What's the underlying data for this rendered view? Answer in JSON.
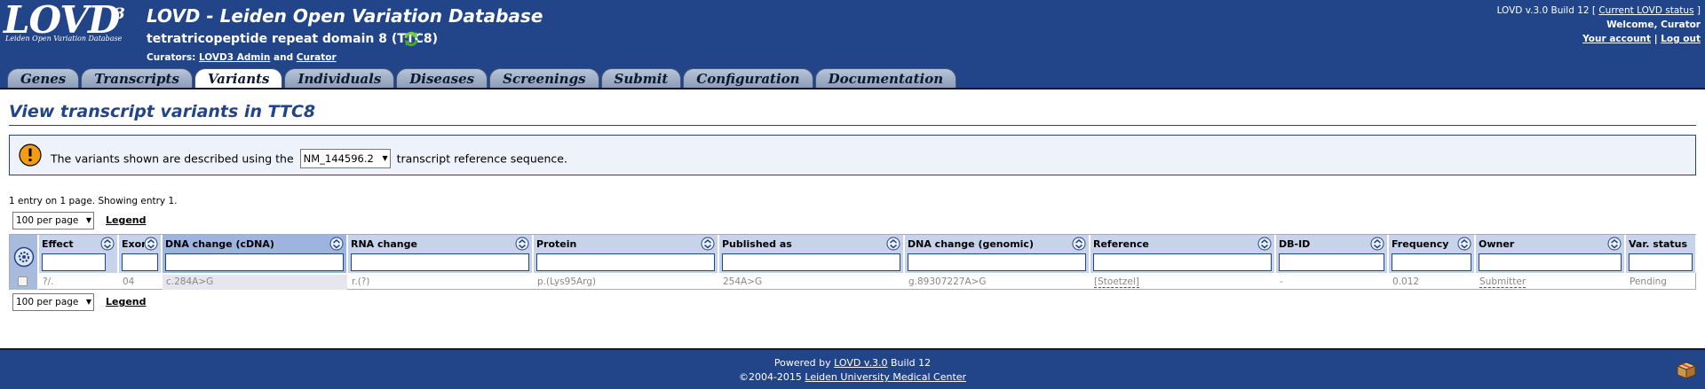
{
  "header": {
    "logo_text": "LOVD",
    "logo_version": "3",
    "logo_subtitle": "Leiden Open Variation Database",
    "app_title": "LOVD - Leiden Open Variation Database",
    "gene_title": "tetratricopeptide repeat domain 8 (TTC8)",
    "curators_prefix": "Curators:",
    "curator_1": "LOVD3 Admin",
    "curators_and": "and",
    "curator_2": "Curator",
    "version_text": "LOVD v.3.0 Build 12 [",
    "status_link": "Current LOVD status",
    "version_close": "]",
    "welcome": "Welcome, Curator",
    "account_link": "Your account",
    "separator": "|",
    "logout_link": "Log out"
  },
  "tabs": [
    {
      "label": "Genes",
      "active": false
    },
    {
      "label": "Transcripts",
      "active": false
    },
    {
      "label": "Variants",
      "active": true
    },
    {
      "label": "Individuals",
      "active": false
    },
    {
      "label": "Diseases",
      "active": false
    },
    {
      "label": "Screenings",
      "active": false
    },
    {
      "label": "Submit",
      "active": false
    },
    {
      "label": "Configuration",
      "active": false
    },
    {
      "label": "Documentation",
      "active": false
    }
  ],
  "page": {
    "heading": "View transcript variants in TTC8",
    "info_before": "The variants shown are described using the",
    "transcript_selected": "NM_144596.2",
    "info_after": "transcript reference sequence.",
    "entry_info": "1 entry on 1 page. Showing entry 1.",
    "per_page": "100 per page",
    "legend": "Legend"
  },
  "table": {
    "columns": [
      {
        "label": "Effect",
        "sorted": false
      },
      {
        "label": "Exon",
        "sorted": false
      },
      {
        "label": "DNA change (cDNA)",
        "sorted": true
      },
      {
        "label": "RNA change",
        "sorted": false
      },
      {
        "label": "Protein",
        "sorted": false
      },
      {
        "label": "Published as",
        "sorted": false
      },
      {
        "label": "DNA change (genomic)",
        "sorted": false
      },
      {
        "label": "Reference",
        "sorted": false
      },
      {
        "label": "DB-ID",
        "sorted": false
      },
      {
        "label": "Frequency",
        "sorted": false
      },
      {
        "label": "Owner",
        "sorted": false
      },
      {
        "label": "Var. status",
        "sorted": false
      }
    ],
    "rows": [
      [
        "?/.",
        "04",
        "c.284A>G",
        "r.(?)",
        "p.(Lys95Arg)",
        "254A>G",
        "g.89307227A>G",
        "[Stoetzel]",
        "-",
        "0.012",
        "Submitter",
        "Pending"
      ]
    ]
  },
  "footer": {
    "powered_prefix": "Powered by",
    "powered_link": "LOVD v.3.0",
    "powered_suffix": "Build 12",
    "copyright_prefix": "©2004-2015",
    "copyright_link": "Leiden University Medical Center"
  },
  "colors": {
    "header_bg": "#224488",
    "sorted_header": "#9db4e0",
    "header_cell": "#c6d3ea",
    "info_icon": "#f39c12"
  },
  "icons": [
    "refresh-icon",
    "info-icon",
    "options-gear-icon",
    "sort-arrows-icon",
    "box-icon"
  ]
}
